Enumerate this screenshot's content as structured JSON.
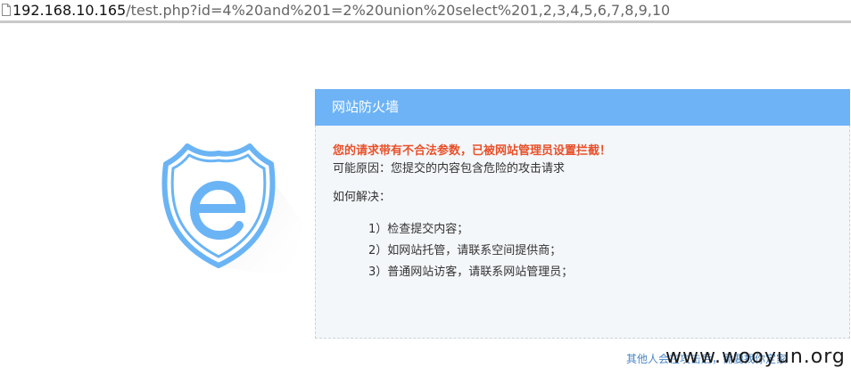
{
  "browser": {
    "url_host": "192.168.10.165",
    "url_rest": "/test.php?id=4%20and%201=2%20union%20select%201,2,3,4,5,6,7,8,9,10",
    "page_icon": "page-icon"
  },
  "firewall": {
    "logo_icon": "shield-e-icon",
    "title": "网站防火墙",
    "warning": "您的请求带有不合法参数，已被网站管理员设置拦截！",
    "reason": "可能原因：您提交的内容包含危险的攻击请求",
    "howto": "如何解决：",
    "steps": [
      "1）检查提交内容；",
      "2）如网站托管，请联系空间提供商；",
      "3）普通网站访客，请联系网站管理员；"
    ],
    "footer_link": "其他人会在攻击后，需要找你定家"
  },
  "watermark": "www.wooyun.org",
  "colors": {
    "header": "#6db3f6",
    "warning": "#e8502a",
    "shield": "#6ab4f5",
    "link": "#4a86c5"
  }
}
